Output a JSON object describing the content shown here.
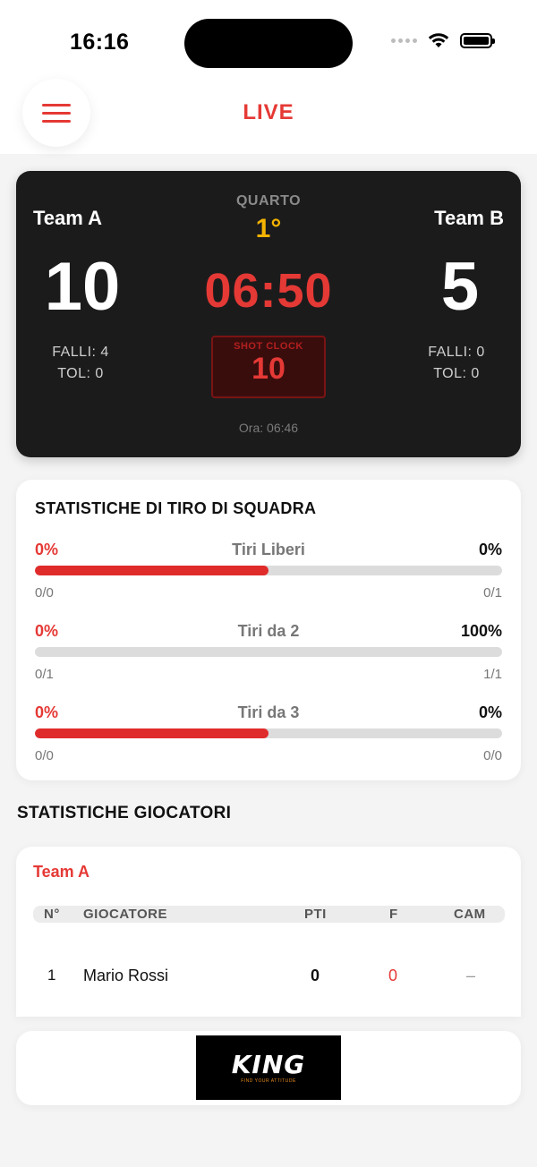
{
  "status_bar": {
    "time": "16:16",
    "icons": [
      "signal-icon",
      "wifi-icon",
      "battery-icon"
    ]
  },
  "header": {
    "title": "LIVE",
    "menu_icon": "hamburger-menu-icon",
    "accent_color": "#e53935"
  },
  "scoreboard": {
    "team_a": {
      "name": "Team A",
      "score": "10",
      "fouls": "FALLI: 4",
      "tol": "TOL: 0"
    },
    "team_b": {
      "name": "Team B",
      "score": "5",
      "fouls": "FALLI: 0",
      "tol": "TOL: 0"
    },
    "quarter_label": "QUARTO",
    "quarter_value": "1°",
    "game_clock": "06:50",
    "shot_clock_label": "SHOT CLOCK",
    "shot_clock_value": "10",
    "update_time": "Ora: 06:46",
    "colors": {
      "background": "#1c1b1c",
      "clock": "#e53935",
      "quarter": "#f5b400"
    }
  },
  "team_shooting": {
    "title": "STATISTICHE DI TIRO DI SQUADRA",
    "stats": [
      {
        "name": "Tiri Liberi",
        "left_pct": "0%",
        "right_pct": "0%",
        "left_sub": "0/0",
        "right_sub": "0/1",
        "fill_fraction": 0.5
      },
      {
        "name": "Tiri da 2",
        "left_pct": "0%",
        "right_pct": "100%",
        "left_sub": "0/1",
        "right_sub": "1/1",
        "fill_fraction": 0
      },
      {
        "name": "Tiri da 3",
        "left_pct": "0%",
        "right_pct": "0%",
        "left_sub": "0/0",
        "right_sub": "0/0",
        "fill_fraction": 0.5
      }
    ]
  },
  "players": {
    "section_title": "STATISTICHE GIOCATORI",
    "team_name": "Team A",
    "columns": [
      "N°",
      "GIOCATORE",
      "PTI",
      "F",
      "CAM"
    ],
    "rows": [
      {
        "number": "1",
        "name": "Mario Rossi",
        "points": "0",
        "fouls": "0",
        "cam": "–"
      }
    ]
  },
  "sponsor": {
    "logo_text": "KING",
    "tagline": "FIND YOUR ATTITUDE"
  }
}
